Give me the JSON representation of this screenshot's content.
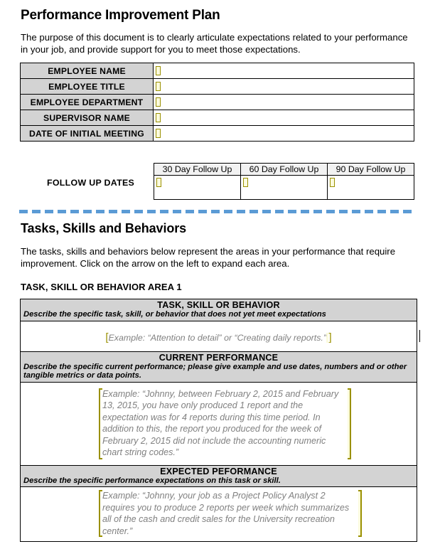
{
  "document": {
    "title": "Performance Improvement Plan",
    "intro": "The purpose of this document is to clearly articulate expectations related to your performance in your job, and provide support for you to meet those expectations."
  },
  "info_table": {
    "rows": [
      {
        "label": "EMPLOYEE NAME",
        "value": ""
      },
      {
        "label": "EMPLOYEE TITLE",
        "value": ""
      },
      {
        "label": "EMPLOYEE DEPARTMENT",
        "value": ""
      },
      {
        "label": "SUPERVISOR NAME",
        "value": ""
      },
      {
        "label": "DATE OF INITIAL MEETING",
        "value": ""
      }
    ]
  },
  "followup": {
    "label": "FOLLOW UP DATES",
    "columns": [
      "30 Day Follow Up",
      "60 Day Follow Up",
      "90 Day Follow Up"
    ],
    "values": [
      "",
      "",
      ""
    ]
  },
  "tasks_section": {
    "title": "Tasks, Skills and Behaviors",
    "description": "The tasks, skills and behaviors below represent the areas in your performance that require improvement. Click on the arrow on the left to expand each area.",
    "area_label": "TASK, SKILL OR BEHAVIOR AREA 1",
    "blocks": [
      {
        "heading": "TASK, SKILL OR BEHAVIOR",
        "subheading": "Describe the specific task, skill, or behavior that does not yet meet expectations",
        "example": "Example: “Attention to detail” or “Creating daily reports.”"
      },
      {
        "heading": "CURRENT PERFORMANCE",
        "subheading": "Describe the specific current performance; please give example and use dates, numbers and or other tangible metrics or data points.",
        "example": "Example: “Johnny, between February 2, 2015 and February 13, 2015, you have only produced 1 report and the expectation was for 4 reports during this time period. In addition to this, the report you produced for the week of February 2, 2015 did not include the accounting numeric chart string codes.”"
      },
      {
        "heading": "EXPECTED PEFORMANCE",
        "subheading": "Describe the specific performance expectations on this task or skill.",
        "example": "Example: “Johnny, your job as a Project Policy Analyst 2 requires you to produce 2 reports per week which summarizes all of the cash and credit sales for the University recreation center.”"
      }
    ]
  },
  "icons": {
    "form_field": "form-field-marker",
    "bracket_open": "[",
    "bracket_close": "]"
  },
  "colors": {
    "header_gray": "#d3d3d3",
    "divider_blue": "#5b9bd5",
    "field_olive": "#9a9000",
    "field_fill": "#fbfbdd",
    "example_text": "#808080"
  }
}
